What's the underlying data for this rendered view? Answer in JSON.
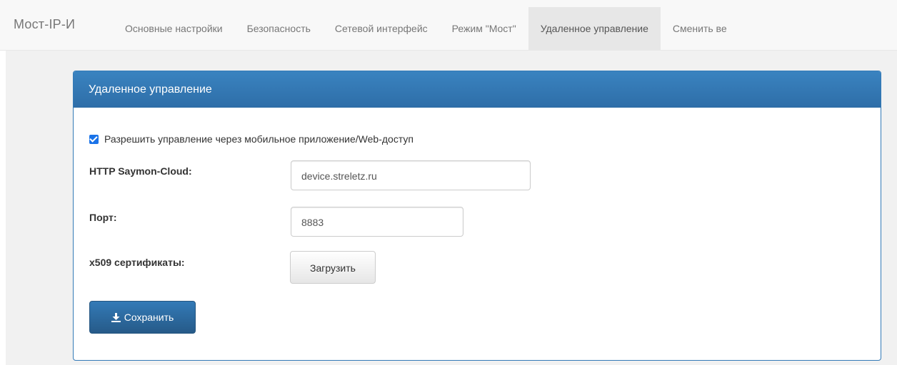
{
  "brand": "Мост-IP-И",
  "nav": {
    "items": [
      {
        "label": "Основные настройки"
      },
      {
        "label": "Безопасность"
      },
      {
        "label": "Сетевой интерфейс"
      },
      {
        "label": "Режим \"Мост\""
      },
      {
        "label": "Удаленное управление"
      },
      {
        "label": "Сменить ве"
      }
    ],
    "active_label": "Удаленное управление"
  },
  "panel": {
    "title": "Удаленное управление",
    "checkbox": {
      "label": "Разрешить управление через мобильное приложение/Web-доступ",
      "checked": true
    },
    "http_label": "HTTP Saymon-Cloud:",
    "http_value": "device.streletz.ru",
    "port_label": "Порт:",
    "port_value": "8883",
    "cert_label": "x509 сертификаты:",
    "upload_button": "Загрузить",
    "save_button": "Сохранить"
  },
  "colors": {
    "accent": "#337ab7",
    "checkbox": "#1a73e8",
    "navbar_bg": "#f8f8f8",
    "page_bg": "#f1f1f1"
  },
  "icons": {
    "save": "download-icon"
  }
}
